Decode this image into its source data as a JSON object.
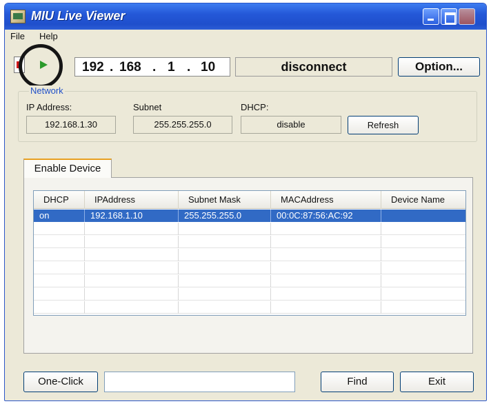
{
  "window": {
    "title": "MIU Live Viewer"
  },
  "menu": {
    "file": "File",
    "help": "Help"
  },
  "toolbar": {
    "ip": {
      "a": "192",
      "b": "168",
      "c": "1",
      "d": "10",
      "dot": "."
    },
    "status": "disconnect",
    "option_label": "Option..."
  },
  "network": {
    "legend": "Network",
    "ip_label": "IP Address:",
    "ip_value": "192.168.1.30",
    "subnet_label": "Subnet",
    "subnet_value": "255.255.255.0",
    "dhcp_label": "DHCP:",
    "dhcp_value": "disable",
    "refresh_label": "Refresh"
  },
  "tab": {
    "label": "Enable Device"
  },
  "devices": {
    "columns": [
      "DHCP",
      "IPAddress",
      "Subnet Mask",
      "MACAddress",
      "Device Name"
    ],
    "rows": [
      {
        "dhcp": "on",
        "ip": "192.168.1.10",
        "mask": "255.255.255.0",
        "mac": "00:0C:87:56:AC:92",
        "name": ""
      }
    ]
  },
  "bottom": {
    "one_click_label": "One-Click",
    "find_label": "Find",
    "exit_label": "Exit"
  }
}
